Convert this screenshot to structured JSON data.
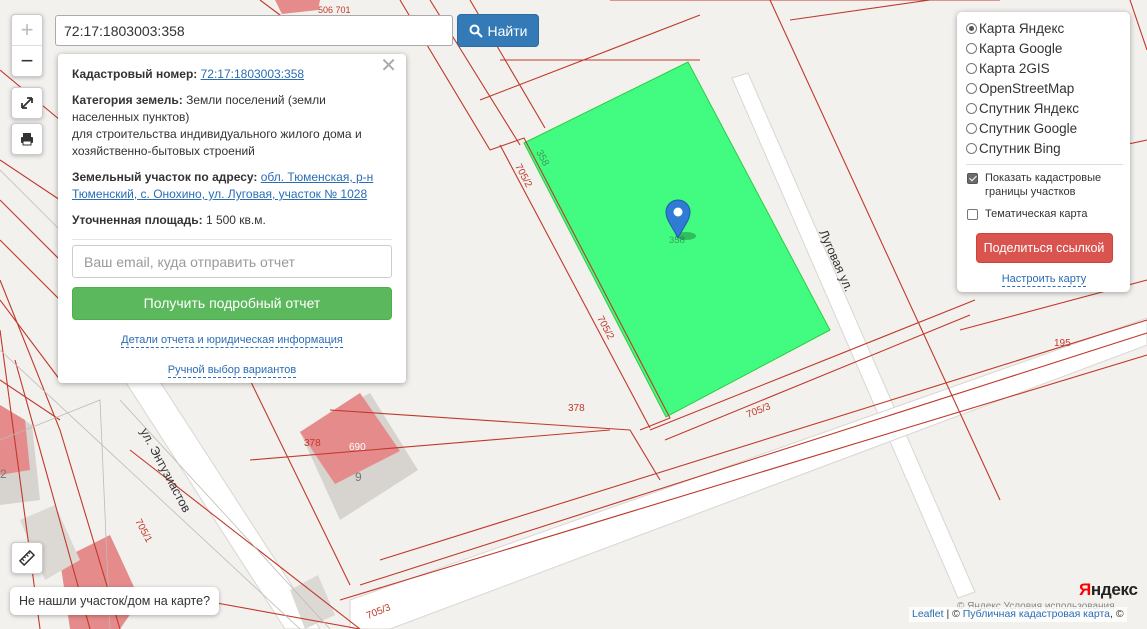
{
  "search": {
    "value": "72:17:1803003:358",
    "button_label": "Найти"
  },
  "popup": {
    "cadastral_label": "Кадастровый номер:",
    "cadastral_number": "72:17:1803003:358",
    "category_label": "Категория земель:",
    "category_text": "Земли поселений (земли населенных пунктов)",
    "purpose_text": "для строительства индивидуального жилого дома и хозяйственно-бытовых строений",
    "address_label": "Земельный участок по адресу:",
    "address_value": "обл. Тюменская, р-н Тюменский, с. Онохино, ул. Луговая, участок № 1028",
    "area_label": "Уточненная площадь:",
    "area_value": "1 500 кв.м.",
    "email_placeholder": "Ваш email, куда отправить отчет",
    "report_button": "Получить подробный отчет",
    "details_link": "Детали отчета и юридическая информация",
    "manual_link": "Ручной выбор вариантов"
  },
  "layers": {
    "options": [
      {
        "label": "Карта Яндекс",
        "selected": true
      },
      {
        "label": "Карта Google",
        "selected": false
      },
      {
        "label": "Карта 2GIS",
        "selected": false
      },
      {
        "label": "OpenStreetMap",
        "selected": false
      },
      {
        "label": "Спутник Яндекс",
        "selected": false
      },
      {
        "label": "Спутник Google",
        "selected": false
      },
      {
        "label": "Спутник Bing",
        "selected": false
      }
    ],
    "show_boundaries_label": "Показать кадастровые границы участков",
    "show_boundaries_checked": true,
    "thematic_label": "Тематическая карта",
    "thematic_checked": false,
    "share_button": "Поделиться ссылкой",
    "configure_link": "Настроить карту"
  },
  "map": {
    "labels": {
      "parcel_358_top": "358",
      "parcel_358_center": "358",
      "lug_street": "Луговая ул.",
      "entuz_street": "ул. Энтузиастов",
      "p705_2_top": "705/2",
      "p705_2_mid": "705/2",
      "p705_3_mid": "705/3",
      "p705_3_bottom": "705/3",
      "p705_1": "705/1",
      "p378_a": "378",
      "p378_b": "378",
      "p195": "195",
      "p690": "690",
      "house_9": "9",
      "top_clip": "506 701",
      "left_clip": "2"
    },
    "colors": {
      "selected_parcel": "#41fc80",
      "parcel_border": "#c0392b",
      "building": "#e58b8b",
      "marker": "#2f7bd6"
    }
  },
  "bottom": {
    "not_found": "Не нашли участок/дом на карте?"
  },
  "attribution": {
    "leaflet": "Leaflet",
    "separator": " | © ",
    "pkk": "Публичная кадастровая карта",
    "tail": ", ©"
  },
  "yandex": {
    "logo_first": "Я",
    "logo_rest": "ндекс",
    "copyright": "© Яндекс Условия использования"
  }
}
